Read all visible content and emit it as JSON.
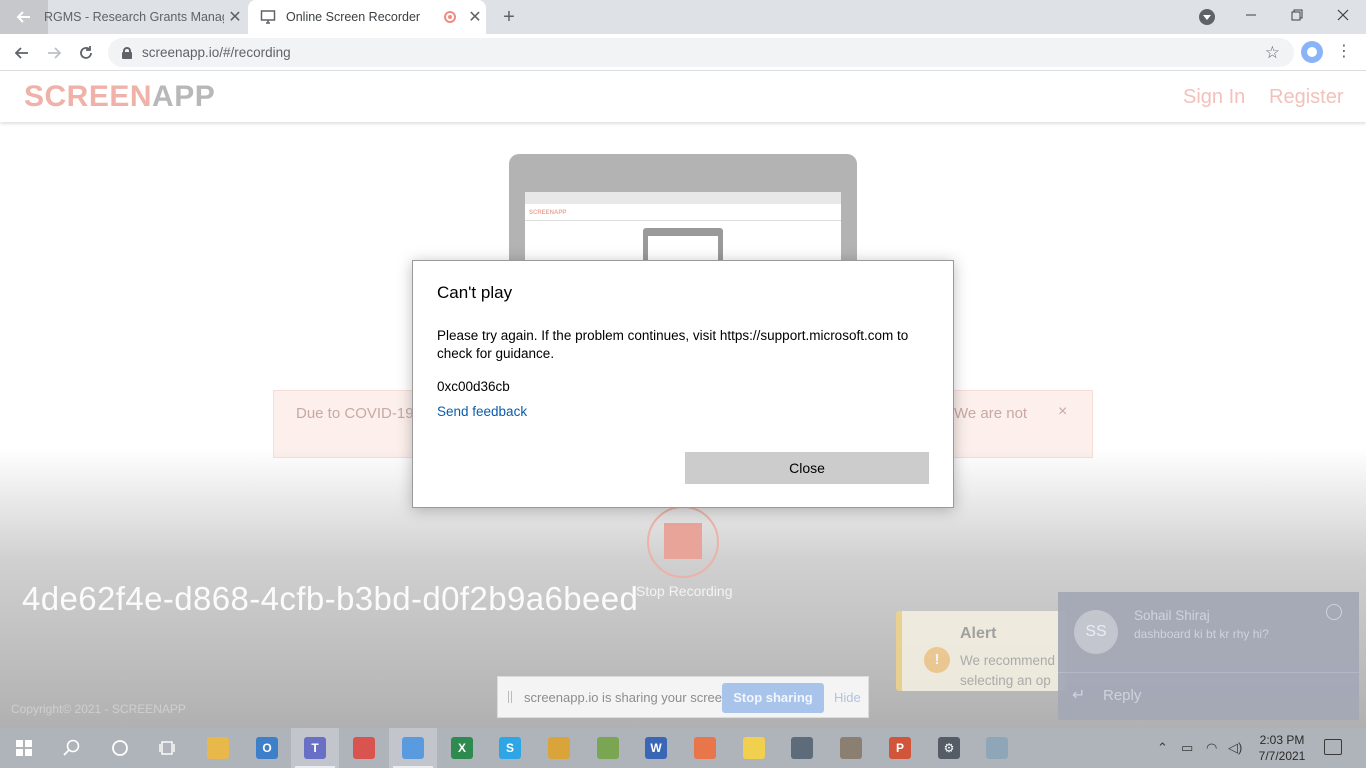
{
  "browser": {
    "tabs": [
      {
        "title": "RGMS - Research Grants Manage",
        "active": false
      },
      {
        "title": "Online Screen Recorder",
        "active": true
      }
    ],
    "url": "screenapp.io/#/recording",
    "new_tab_label": "+",
    "close_glyph": "✕"
  },
  "site": {
    "logo_part1": "SCREEN",
    "logo_part2": "APP",
    "sign_in": "Sign In",
    "register": "Register",
    "mini_logo": "SCREENAPP",
    "covid_left": "Due to COVID-19",
    "covid_right": "We are not",
    "covid_close": "×",
    "stop_recording": "Stop Recording",
    "recording_id": "4de62f4e-d868-4cfb-b3bd-d0f2b9a6beed",
    "copyright": "Copyright©   2021 - SCREENAPP"
  },
  "alert": {
    "icon": "!",
    "title": "Alert",
    "line1": "We recommend",
    "line2": "selecting an op"
  },
  "share_bar": {
    "text": "screenapp.io is sharing your screen.",
    "stop_button": "Stop sharing",
    "hide": "Hide"
  },
  "chat": {
    "initials": "SS",
    "name": "Sohail Shiraj",
    "message": "dashboard ki bt kr rhy hi?",
    "reply": "Reply"
  },
  "dialog": {
    "title": "Can't play",
    "body": "Please try again. If the problem continues, visit https://support.microsoft.com to check for guidance.",
    "code": "0xc00d36cb",
    "link": "Send feedback",
    "close_button": "Close"
  },
  "taskbar": {
    "time": "2:03 PM",
    "date": "7/7/2021",
    "apps": [
      {
        "name": "file-explorer-icon",
        "color": "#e8b84a",
        "glyph": ""
      },
      {
        "name": "outlook-icon",
        "color": "#3d7fc9",
        "glyph": "O"
      },
      {
        "name": "teams-icon",
        "color": "#6a6fc6",
        "glyph": "T"
      },
      {
        "name": "chrome-icon",
        "color": "#d9534f",
        "glyph": ""
      },
      {
        "name": "chrome-profile-icon",
        "color": "#5a9be0",
        "glyph": ""
      },
      {
        "name": "excel-icon",
        "color": "#2f8a4f",
        "glyph": "X"
      },
      {
        "name": "skype-icon",
        "color": "#2ea6e6",
        "glyph": "S"
      },
      {
        "name": "files-icon",
        "color": "#d9a53a",
        "glyph": ""
      },
      {
        "name": "notes-icon",
        "color": "#7aa653",
        "glyph": ""
      },
      {
        "name": "word-icon",
        "color": "#3a67b5",
        "glyph": "W"
      },
      {
        "name": "media-icon",
        "color": "#e8764a",
        "glyph": ""
      },
      {
        "name": "sticky-notes-icon",
        "color": "#f2d04f",
        "glyph": ""
      },
      {
        "name": "window-icon",
        "color": "#5d6b7a",
        "glyph": ""
      },
      {
        "name": "tools-icon",
        "color": "#8a7f70",
        "glyph": ""
      },
      {
        "name": "powerpoint-icon",
        "color": "#d0553a",
        "glyph": "P"
      },
      {
        "name": "settings-icon",
        "color": "#555c66",
        "glyph": "⚙"
      },
      {
        "name": "app-icon",
        "color": "#8fa6b8",
        "glyph": ""
      }
    ],
    "active_indexes": [
      2,
      4
    ]
  }
}
